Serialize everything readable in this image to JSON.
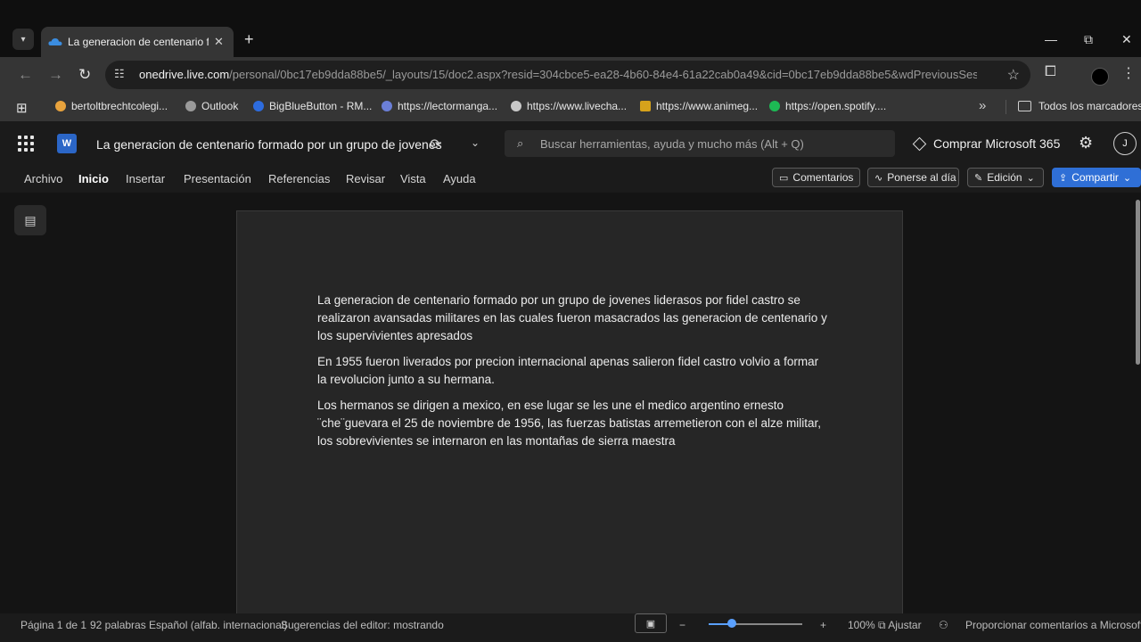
{
  "browser": {
    "tab_menu_icon": "chevron-down-icon",
    "tab": {
      "title": "La generacion de centenario fo",
      "close": "✕"
    },
    "new_tab": "+",
    "window": {
      "minimize": "—",
      "restore": "⧉",
      "close": "✕"
    },
    "nav": {
      "back": "←",
      "forward": "→",
      "reload": "↻"
    },
    "url": {
      "host": "onedrive.live.com",
      "path": "/personal/0bc17eb9dda88be5/_layouts/15/doc2.aspx?resid=304cbce5-ea28-4b60-84e4-61a22cab0a49&cid=0bc17eb9dda88be5&wdPreviousSes..."
    },
    "bookmarks": [
      {
        "label": "bertoltbrechtcolegi...",
        "color": "#e8a33d"
      },
      {
        "label": "Outlook",
        "color": "#9a9a9a"
      },
      {
        "label": "BigBlueButton - RM...",
        "color": "#2d6cdf"
      },
      {
        "label": "https://lectormanga...",
        "color": "#6b7fd7"
      },
      {
        "label": "https://www.livecha...",
        "color": "#c9c9c9"
      },
      {
        "label": "https://www.animeg...",
        "color": "#d6a21b"
      },
      {
        "label": "https://open.spotify....",
        "color": "#1db954"
      }
    ],
    "all_bookmarks": "Todos los marcadores"
  },
  "word": {
    "app_logo": "W",
    "title": "La generacion de centenario formado por un grupo de jovenes",
    "search_placeholder": "Buscar herramientas, ayuda y mucho más (Alt + Q)",
    "buy": "Comprar Microsoft 365",
    "avatar_initial": "J",
    "ribbon_tabs": [
      "Archivo",
      "Inicio",
      "Insertar",
      "Presentación",
      "Referencias",
      "Revisar",
      "Vista",
      "Ayuda"
    ],
    "active_tab": "Inicio",
    "buttons": {
      "comments": "Comentarios",
      "catch_up": "Ponerse al día",
      "editing": "Edición",
      "share": "Compartir"
    }
  },
  "document": {
    "paragraphs": [
      "La generacion de centenario formado por un grupo de jovenes liderasos por fidel castro se realizaron avansadas militares en las cuales fueron masacrados las generacion de centenario y los supervivientes apresados",
      "En 1955 fueron liverados por precion internacional apenas salieron fidel castro volvio a formar la revolucion junto a su hermana.",
      "Los hermanos se dirigen a mexico, en ese lugar se les une el medico argentino ernesto ¨che¨guevara el 25 de noviembre de 1956, las fuerzas batistas arremetieron con el alze militar, los sobrevivientes se internaron en las montañas de sierra maestra"
    ]
  },
  "status": {
    "page": "Página 1 de 1",
    "words": "92 palabras",
    "language": "Español (alfab. internacional)",
    "suggestions": "Sugerencias del editor: mostrando",
    "zoom": "100%",
    "zoom_level": 0.25,
    "fit": "Ajustar",
    "feedback": "Proporcionar comentarios a Microsoft"
  }
}
